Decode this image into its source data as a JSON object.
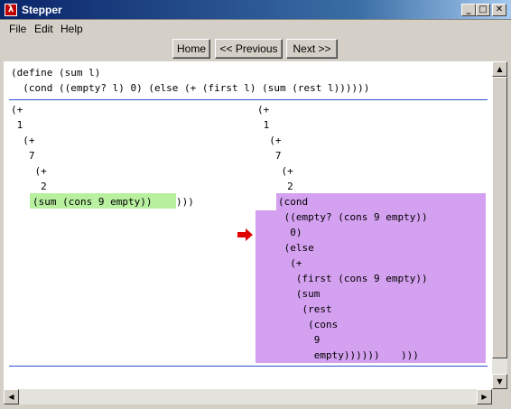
{
  "window": {
    "title": "Stepper"
  },
  "titlebar_buttons": {
    "minimize": "_",
    "maximize": "□",
    "close": "✕"
  },
  "menu": [
    "File",
    "Edit",
    "Help"
  ],
  "nav": {
    "home": "Home",
    "previous": "<< Previous",
    "next": "Next >>"
  },
  "definition": [
    "(define (sum l)",
    "  (cond ((empty? l) 0) (else (+ (first l) (sum (rest l))))))"
  ],
  "left_expr": [
    "(+",
    " 1",
    "  (+",
    "   7",
    "    (+",
    "     2"
  ],
  "left_redex": "(sum (cons 9 empty))",
  "left_redex_tail": ")))",
  "right_expr": [
    "(+",
    " 1",
    "  (+",
    "   7",
    "    (+",
    "     2"
  ],
  "right_reduct": [
    "(cond",
    " ((empty? (cons 9 empty))",
    "  0)",
    " (else",
    "  (+",
    "   (first (cons 9 empty))",
    "   (sum",
    "    (rest",
    "     (cons",
    "      9",
    "      empty))))))"
  ],
  "right_reduct_tail": ")))",
  "colors": {
    "redex_highlight": "#b8f0a0",
    "reduct_highlight": "#d4a0f0",
    "separator": "#2f4fd0",
    "arrow": "#e00000"
  },
  "icons": {
    "app": "lambda-icon",
    "step_arrow": "red-arrow-icon"
  }
}
